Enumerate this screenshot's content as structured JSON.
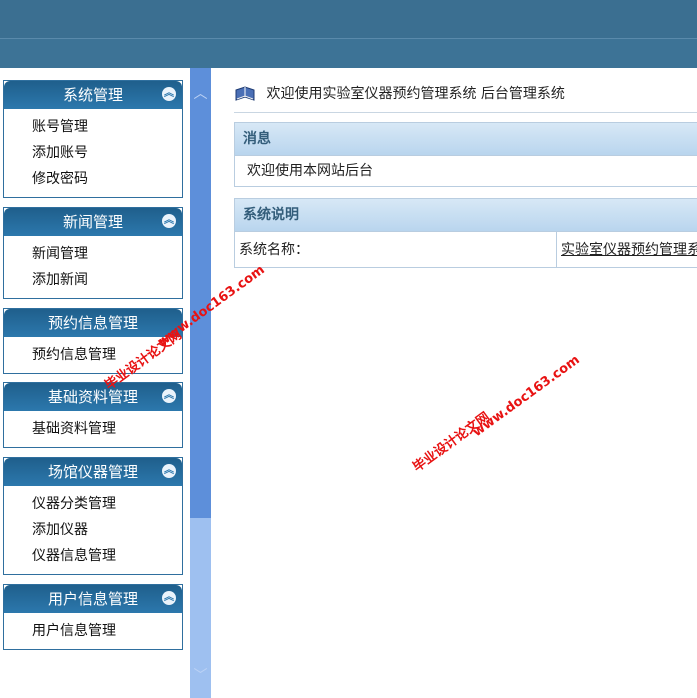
{
  "sidebar": {
    "groups": [
      {
        "title": "系统管理",
        "items": [
          "账号管理",
          "添加账号",
          "修改密码"
        ]
      },
      {
        "title": "新闻管理",
        "items": [
          "新闻管理",
          "添加新闻"
        ]
      },
      {
        "title": "预约信息管理",
        "items": [
          "预约信息管理"
        ]
      },
      {
        "title": "基础资料管理",
        "items": [
          "基础资料管理"
        ]
      },
      {
        "title": "场馆仪器管理",
        "items": [
          "仪器分类管理",
          "添加仪器",
          "仪器信息管理"
        ]
      },
      {
        "title": "用户信息管理",
        "items": [
          "用户信息管理"
        ]
      }
    ]
  },
  "main": {
    "welcome": "欢迎使用实验室仪器预约管理系统 后台管理系统",
    "news_panel": {
      "title": "消息",
      "body": "欢迎使用本网站后台"
    },
    "system_panel": {
      "title": "系统说明",
      "label": "系统名称：",
      "value": "实验室仪器预约管理系"
    }
  },
  "watermark": {
    "line1": "毕业设计论文网",
    "line2": "www.doc163.com"
  },
  "colors": {
    "header": "#3b6f91",
    "sidebar": "#2f6f9e",
    "scroll": "#5d8fda",
    "panel_head": "#d7e8f6",
    "watermark": "#e81212"
  }
}
